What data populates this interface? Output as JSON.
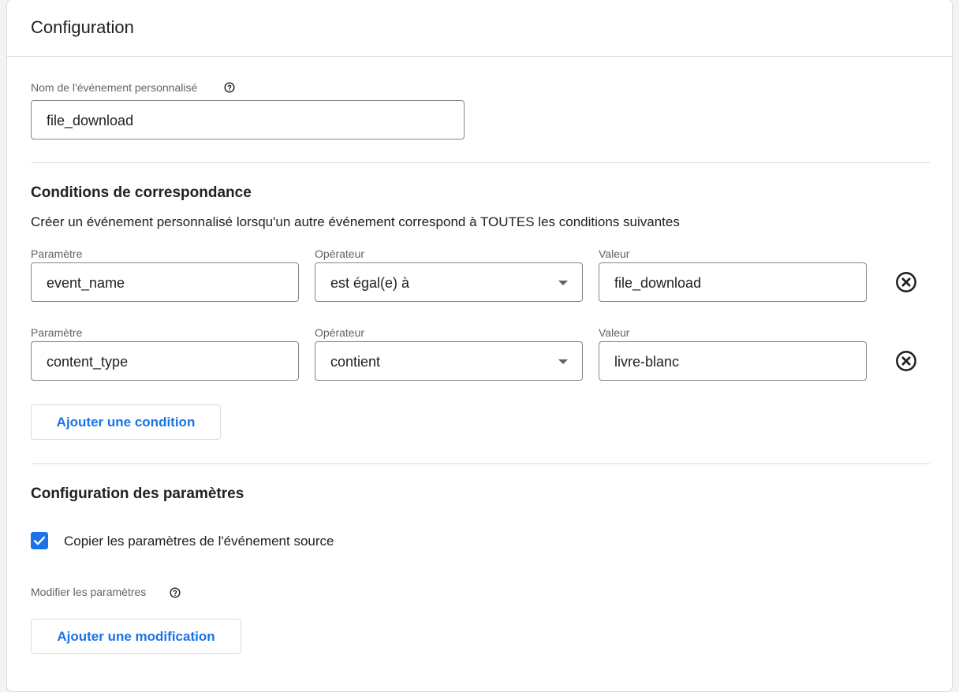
{
  "header": {
    "title": "Configuration"
  },
  "event_name": {
    "label": "Nom de l'événement personnalisé",
    "value": "file_download",
    "help_icon": "help-circle-icon"
  },
  "conditions": {
    "title": "Conditions de correspondance",
    "description": "Créer un événement personnalisé lorsqu'un autre événement correspond à TOUTES les conditions suivantes",
    "param_label": "Paramètre",
    "operator_label": "Opérateur",
    "value_label": "Valeur",
    "rows": [
      {
        "parameter": "event_name",
        "operator": "est égal(e) à",
        "value": "file_download"
      },
      {
        "parameter": "content_type",
        "operator": "contient",
        "value": "livre-blanc"
      }
    ],
    "remove_icon": "close-circle-icon",
    "add_button": "Ajouter une condition"
  },
  "params": {
    "title": "Configuration des paramètres",
    "copy_checkbox": {
      "label": "Copier les paramètres de l'événement source",
      "checked": true
    },
    "modify_label": "Modifier les paramètres",
    "add_button": "Ajouter une modification"
  },
  "colors": {
    "accent": "#1a73e8",
    "border": "#dadce0",
    "input_border": "#80868b",
    "text": "#202124",
    "muted": "#5f6368"
  }
}
